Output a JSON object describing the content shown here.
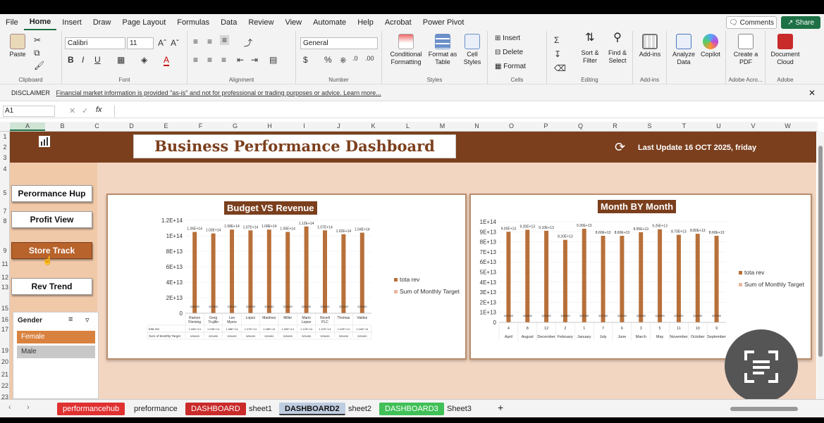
{
  "menu": {
    "tabs": [
      "File",
      "Home",
      "Insert",
      "Draw",
      "Page Layout",
      "Formulas",
      "Data",
      "Review",
      "View",
      "Automate",
      "Help",
      "Acrobat",
      "Power Pivot"
    ],
    "active": "Home",
    "comments_label": "Comments",
    "share_label": "Share"
  },
  "ribbon": {
    "clipboard": {
      "paste": "Paste",
      "group": "Clipboard"
    },
    "font": {
      "name": "Calibri",
      "size": "11",
      "group": "Font"
    },
    "alignment": {
      "group": "Alignment"
    },
    "number": {
      "format": "General",
      "group": "Number"
    },
    "styles": {
      "conditional": "Conditional Formatting",
      "format_table": "Format as Table",
      "cell_styles": "Cell Styles",
      "group": "Styles"
    },
    "cells": {
      "insert": "Insert",
      "delete": "Delete",
      "format": "Format",
      "group": "Cells"
    },
    "editing": {
      "sort": "Sort & Filter",
      "find": "Find & Select",
      "group": "Editing"
    },
    "addins": {
      "label": "Add-ins",
      "group": "Add-ins"
    },
    "analyze": {
      "label": "Analyze Data"
    },
    "copilot": {
      "label": "Copilot"
    },
    "adobe_pdf": {
      "label": "Create a PDF",
      "group": "Adobe Acro..."
    },
    "adobe_cloud": {
      "label": "Document Cloud",
      "group": "Adobe"
    }
  },
  "disclaimer": {
    "label": "DISCLAIMER",
    "text": "Financial market information is provided \"as-is\" and not for professional or trading purposes or advice. Learn more..."
  },
  "formula_bar": {
    "cell_ref": "A1",
    "fx": "fx",
    "value": ""
  },
  "columns": [
    "A",
    "B",
    "C",
    "D",
    "E",
    "F",
    "G",
    "H",
    "I",
    "J",
    "K",
    "L",
    "M",
    "N",
    "O",
    "P",
    "Q",
    "R",
    "S",
    "T",
    "U",
    "V",
    "W"
  ],
  "rows": [
    "1",
    "2",
    "3",
    "4",
    "5",
    "7",
    "8",
    "9",
    "11",
    "12",
    "13",
    "15",
    "16",
    "17",
    "19",
    "20",
    "21",
    "22",
    "23",
    "25",
    "26",
    "27"
  ],
  "dashboard": {
    "title": "Business Performance Dashboard",
    "last_update": "Last Update 16 OCT 2025, friday",
    "nav": [
      "Perormance Hup",
      "Profit View",
      "Store Track",
      "Rev Trend"
    ],
    "slicer": {
      "title": "Gender",
      "items": [
        "Female",
        "Male"
      ]
    }
  },
  "chart_data": [
    {
      "type": "bar",
      "title": "Budget VS Revenue",
      "categories": [
        "Ramon Fleming",
        "Greg Trujillo",
        "Leo Myers",
        "Lopez",
        "Martinez",
        "Miller",
        "Mario Lopez",
        "Novell PLC",
        "Thomas",
        "Valdez"
      ],
      "series": [
        {
          "name": "tota rev",
          "values": [
            105000000000000.0,
            103000000000000.0,
            108000000000000.0,
            107000000000000.0,
            108000000000000.0,
            105000000000000.0,
            112000000000000.0,
            107000000000000.0,
            102000000000000.0,
            104000000000000.0
          ]
        },
        {
          "name": "Sum of Monthly Target",
          "values": [
            325490,
            325490,
            325490,
            325490,
            325490,
            325490,
            325490,
            325490,
            325490,
            325490
          ]
        }
      ],
      "y_ticks": [
        "0",
        "2E+13",
        "4E+13",
        "6E+13",
        "8E+13",
        "1E+14",
        "1.2E+14"
      ],
      "ylim": [
        0,
        120000000000000.0
      ],
      "legend": "right",
      "table_rows": [
        "tota rev",
        "Sum of Monthly Target"
      ]
    },
    {
      "type": "bar",
      "title": "Month BY Month",
      "categories": [
        "August",
        "December",
        "February",
        "January",
        "July",
        "June",
        "March",
        "May",
        "November",
        "October",
        "September"
      ],
      "category_numbers": [
        "4",
        "8",
        "12",
        "2",
        "1",
        "7",
        "6",
        "3",
        "5",
        "11",
        "10",
        "9"
      ],
      "x_labels": [
        "April",
        "August",
        "December",
        "February",
        "January",
        "July",
        "June",
        "March",
        "May",
        "November",
        "October",
        "September"
      ],
      "series": [
        {
          "name": "tota rev",
          "values": [
            90000000000000.0,
            92000000000000.0,
            91000000000000.0,
            82000000000000.0,
            93000000000000.0,
            86000000000000.0,
            86000000000000.0,
            89500000000000.0,
            92500000000000.0,
            87000000000000.0,
            88000000000000.0,
            86000000000000.0
          ]
        },
        {
          "name": "Sum of Monthly Target",
          "values": [
            325490,
            325490,
            325490,
            325490,
            325490,
            325490,
            325490,
            325490,
            325490,
            325490,
            325490,
            325490
          ]
        }
      ],
      "y_ticks": [
        "0",
        "1E+13",
        "2E+13",
        "3E+13",
        "4E+13",
        "5E+13",
        "6E+13",
        "7E+13",
        "8E+13",
        "9E+13",
        "1E+14"
      ],
      "ylim": [
        0,
        100000000000000.0
      ],
      "legend": "right"
    }
  ],
  "sheet_tabs": [
    {
      "label": "performancehub",
      "color": "#e03131"
    },
    {
      "label": "preformance",
      "color": ""
    },
    {
      "label": "DASHBOARD",
      "color": "#c92a2a"
    },
    {
      "label": "sheet1",
      "color": ""
    },
    {
      "label": "DASHBOARD2",
      "color": "#bfcde0"
    },
    {
      "label": "sheet2",
      "color": ""
    },
    {
      "label": "DASHBOARD3",
      "color": "#40c057"
    },
    {
      "label": "Sheet3",
      "color": ""
    }
  ],
  "colors": {
    "brown": "#7b3f1d",
    "bar": "#b8703a",
    "sheet_bg": "#f3d6c2",
    "excel_green": "#1e7145"
  }
}
